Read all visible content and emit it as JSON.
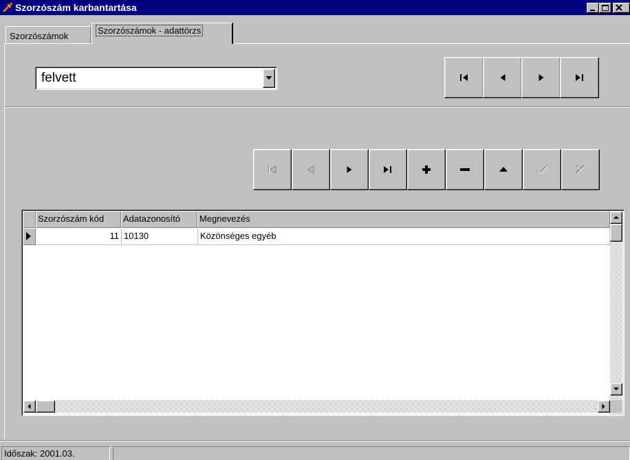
{
  "window": {
    "title": "Szorzószám karbantartása"
  },
  "tabs": [
    {
      "label": "Szorzószámok"
    },
    {
      "label": "Szorzószámok - adattörzs"
    }
  ],
  "filter": {
    "selected": "felvett"
  },
  "top_navigator": [
    {
      "name": "first",
      "icon": "first-record-icon"
    },
    {
      "name": "prior",
      "icon": "prior-record-icon"
    },
    {
      "name": "next",
      "icon": "next-record-icon"
    },
    {
      "name": "last",
      "icon": "last-record-icon"
    }
  ],
  "grid_navigator": [
    {
      "name": "first",
      "icon": "first-record-icon",
      "enabled": false
    },
    {
      "name": "prior",
      "icon": "prior-record-icon",
      "enabled": false
    },
    {
      "name": "next",
      "icon": "next-record-icon",
      "enabled": true
    },
    {
      "name": "last",
      "icon": "last-record-icon",
      "enabled": true
    },
    {
      "name": "insert",
      "icon": "plus-icon",
      "enabled": true
    },
    {
      "name": "delete",
      "icon": "minus-icon",
      "enabled": true
    },
    {
      "name": "edit",
      "icon": "up-triangle-icon",
      "enabled": true
    },
    {
      "name": "post",
      "icon": "checkmark-icon",
      "enabled": false
    },
    {
      "name": "cancel",
      "icon": "x-icon",
      "enabled": false
    }
  ],
  "grid": {
    "columns": [
      "Szorzószám kód",
      "Adatazonosító",
      "Megnevezés"
    ],
    "rows": [
      [
        "11",
        "10130",
        "Közönséges egyéb"
      ]
    ]
  },
  "status": {
    "period": "Időszak: 2001.03."
  },
  "colors": {
    "titlebar": "#000080",
    "face": "#c0c0c0"
  }
}
